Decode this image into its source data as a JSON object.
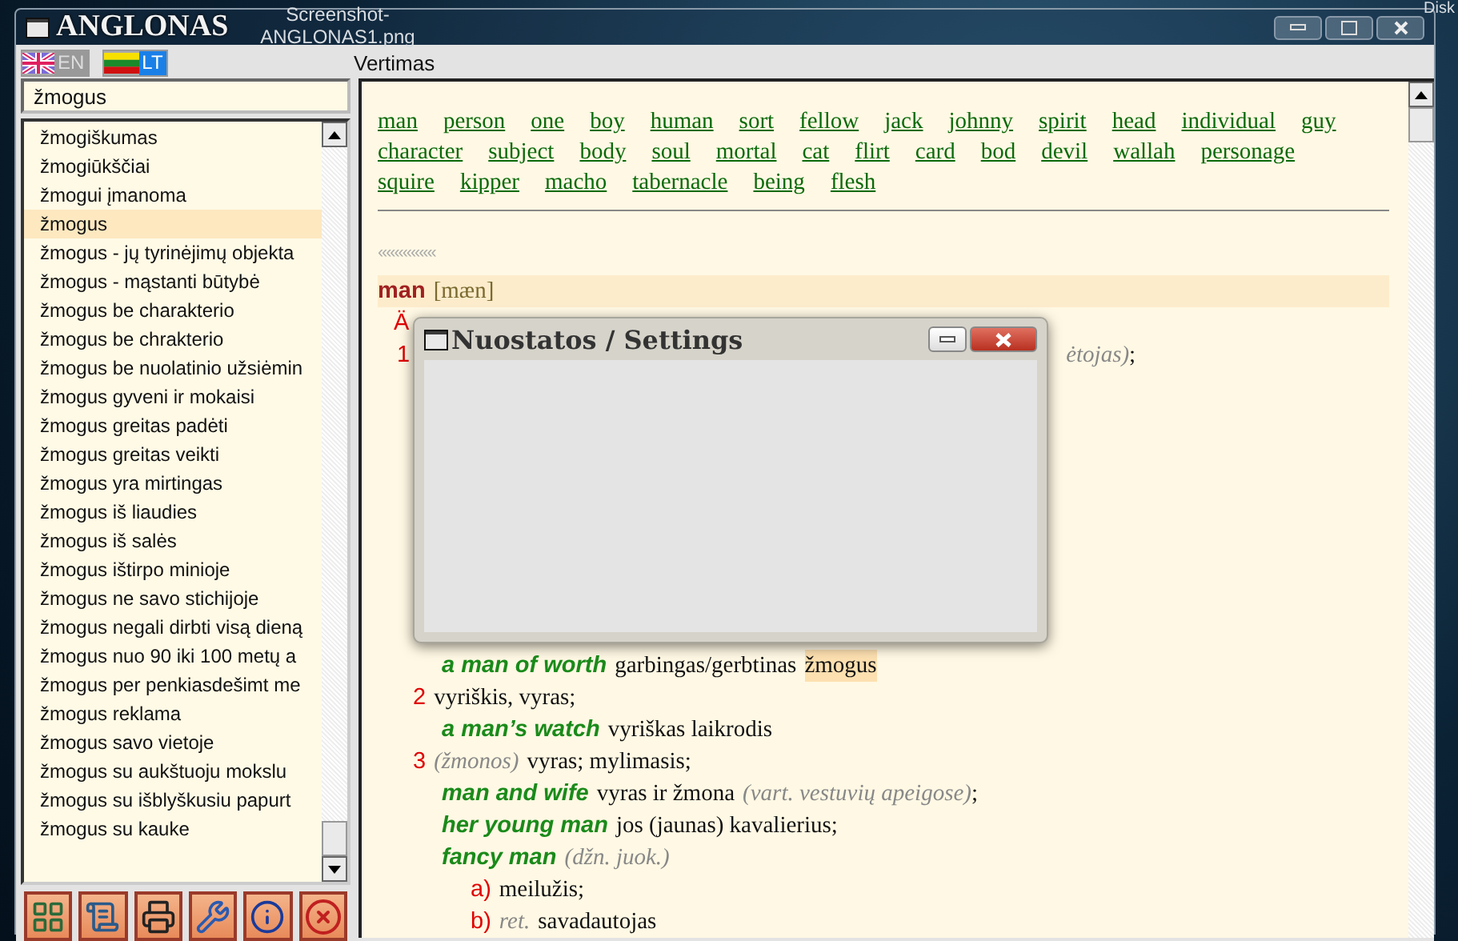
{
  "desktop_labels": [
    {
      "kind": "file",
      "text": "Screenshot-ANGLONAS1.png"
    },
    {
      "kind": "corner",
      "text": "Disk"
    }
  ],
  "window": {
    "title": "ANGLONAS"
  },
  "languages": [
    {
      "code": "EN",
      "kind": "uk",
      "selected": false
    },
    {
      "code": "LT",
      "kind": "lt",
      "selected": true
    }
  ],
  "panel_title": "Vertimas",
  "search": {
    "value": "žmogus"
  },
  "word_list": [
    {
      "text": "žmogiškumas",
      "selected": false
    },
    {
      "text": "žmogiūkščiai",
      "selected": false
    },
    {
      "text": "žmogui įmanoma",
      "selected": false
    },
    {
      "text": "žmogus",
      "selected": true
    },
    {
      "text": "žmogus - jų tyrinėjimų objekta",
      "selected": false
    },
    {
      "text": "žmogus - mąstanti būtybė",
      "selected": false
    },
    {
      "text": "žmogus be charakterio",
      "selected": false
    },
    {
      "text": "žmogus be chrakterio",
      "selected": false
    },
    {
      "text": "žmogus be nuolatinio užsiėmin",
      "selected": false
    },
    {
      "text": "žmogus gyveni ir mokaisi",
      "selected": false
    },
    {
      "text": "žmogus greitas padėti",
      "selected": false
    },
    {
      "text": "žmogus greitas veikti",
      "selected": false
    },
    {
      "text": "žmogus yra mirtingas",
      "selected": false
    },
    {
      "text": "žmogus iš liaudies",
      "selected": false
    },
    {
      "text": "žmogus iš salės",
      "selected": false
    },
    {
      "text": "žmogus ištirpo minioje",
      "selected": false
    },
    {
      "text": "žmogus ne savo stichijoje",
      "selected": false
    },
    {
      "text": "žmogus negali dirbti visą dieną",
      "selected": false
    },
    {
      "text": "žmogus nuo 90 iki 100 metų a",
      "selected": false
    },
    {
      "text": "žmogus per penkiasdešimt me",
      "selected": false
    },
    {
      "text": "žmogus reklama",
      "selected": false
    },
    {
      "text": "žmogus savo vietoje",
      "selected": false
    },
    {
      "text": "žmogus su aukštuoju mokslu",
      "selected": false
    },
    {
      "text": "žmogus su išblyškusiu papurt",
      "selected": false
    },
    {
      "text": "žmogus su kauke",
      "selected": false
    }
  ],
  "toolbar": [
    {
      "kind": "grid"
    },
    {
      "kind": "scroll"
    },
    {
      "kind": "print"
    },
    {
      "kind": "wrench"
    },
    {
      "kind": "info"
    },
    {
      "kind": "close"
    }
  ],
  "synonyms": [
    "man",
    "person",
    "one",
    "boy",
    "human",
    "sort",
    "fellow",
    "jack",
    "johnny",
    "spirit",
    "head",
    "individual",
    "guy",
    "character",
    "subject",
    "body",
    "soul",
    "mortal",
    "cat",
    "flirt",
    "card",
    "bod",
    "devil",
    "wallah",
    "personage",
    "squire",
    "kipper",
    "macho",
    "tabernacle",
    "being",
    "flesh"
  ],
  "back_link": "«««««««",
  "entry": [
    {
      "kind": "head",
      "parts": [
        {
          "kind": "head",
          "text": "man"
        },
        {
          "kind": "phon",
          "text": "[mæn]"
        }
      ]
    },
    {
      "kind": "pos",
      "parts": [
        {
          "kind": "num",
          "text": "Ä"
        }
      ]
    },
    {
      "kind": "split",
      "parts": [
        {
          "kind": "num",
          "text": "1"
        },
        {
          "kind": "note",
          "text": "ėtojas)"
        },
        {
          "kind": "tail",
          "text": ";"
        }
      ]
    },
    {
      "kind": "gap"
    },
    {
      "kind": "example",
      "parts": [
        {
          "kind": "phrase",
          "text": "a man of worth"
        },
        {
          "kind": "text",
          "text": "garbingas/gerbtinas"
        },
        {
          "kind": "mark",
          "text": "žmogus"
        }
      ]
    },
    {
      "kind": "sense",
      "parts": [
        {
          "kind": "num",
          "text": "2"
        },
        {
          "kind": "text",
          "text": "vyriškis, vyras;"
        }
      ]
    },
    {
      "kind": "example",
      "parts": [
        {
          "kind": "phrase",
          "text": "a man’s watch"
        },
        {
          "kind": "text",
          "text": "vyriškas laikrodis"
        }
      ]
    },
    {
      "kind": "sense",
      "parts": [
        {
          "kind": "num",
          "text": "3"
        },
        {
          "kind": "note",
          "text": "(žmonos)"
        },
        {
          "kind": "text",
          "text": "vyras; mylimasis;"
        }
      ]
    },
    {
      "kind": "example",
      "parts": [
        {
          "kind": "phrase",
          "text": "man and wife"
        },
        {
          "kind": "text",
          "text": "vyras ir žmona"
        },
        {
          "kind": "note",
          "text": "(vart. vestuvių apeigose)"
        },
        {
          "kind": "tail",
          "text": ";"
        }
      ]
    },
    {
      "kind": "example",
      "parts": [
        {
          "kind": "phrase",
          "text": "her young man"
        },
        {
          "kind": "text",
          "text": "jos (jaunas) kavalierius;"
        }
      ]
    },
    {
      "kind": "example",
      "parts": [
        {
          "kind": "phrase",
          "text": "fancy man"
        },
        {
          "kind": "note",
          "text": "(džn. juok.)"
        }
      ]
    },
    {
      "kind": "sub",
      "parts": [
        {
          "kind": "num",
          "text": "a)"
        },
        {
          "kind": "text",
          "text": "meilužis;"
        }
      ]
    },
    {
      "kind": "sub",
      "parts": [
        {
          "kind": "num",
          "text": "b)"
        },
        {
          "kind": "note",
          "text": "ret."
        },
        {
          "kind": "text",
          "text": "savadautojas"
        }
      ]
    }
  ],
  "dialog": {
    "title": "Nuostatos / Settings"
  }
}
